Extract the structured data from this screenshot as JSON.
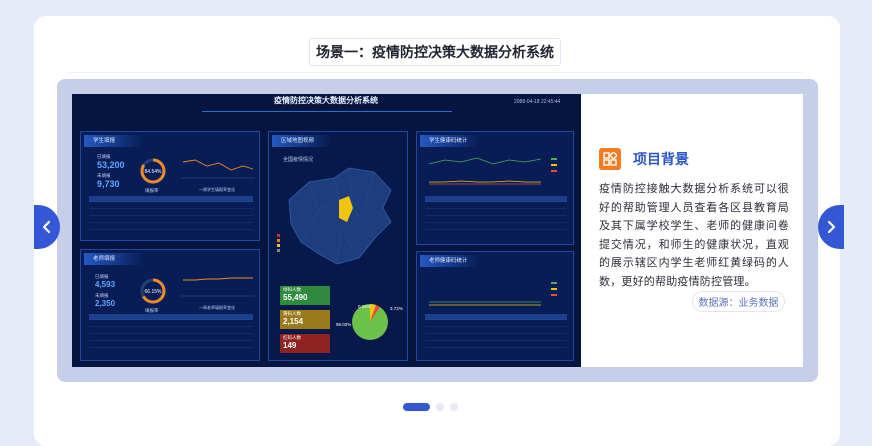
{
  "scene": {
    "title": "场景一：疫情防控决策大数据分析系统"
  },
  "dashboard": {
    "title": "疫情防控决策大数据分析系统",
    "time": "2088-04-18 22:45:44",
    "student_panel": {
      "title": "学生填报",
      "reported_label": "已填报",
      "reported_value": "53,200",
      "unreported_label": "未填报",
      "unreported_value": "9,730",
      "rate": "84.54%",
      "rate_label": "填报率",
      "chart_caption": "一周学生填报率变化"
    },
    "teacher_panel": {
      "title": "老师填报",
      "reported_label": "已填报",
      "reported_value": "4,593",
      "unreported_label": "未填报",
      "unreported_value": "2,350",
      "rate": "66.15%",
      "rate_label": "填报率",
      "chart_caption": "一周老师填报率变化"
    },
    "map_panel": {
      "title": "区域地图视频",
      "subtitle": "全国疫情情况"
    },
    "student_health": {
      "title": "学生健康码统计"
    },
    "teacher_health": {
      "title": "老师健康码统计"
    },
    "codes": {
      "green": {
        "label": "绿码人数",
        "value": "55,490",
        "color": "#2e8a3c"
      },
      "yellow": {
        "label": "黄码人数",
        "value": "2,154",
        "color": "#9b7a1a"
      },
      "red": {
        "label": "红码人数",
        "value": "149",
        "color": "#8f2323"
      }
    },
    "pie": {
      "green_pct": "95.02%",
      "yellow_pct": "0.26%",
      "red_pct": "3.72%"
    }
  },
  "info": {
    "title": "项目背景",
    "icon": "grid-apps-icon",
    "body": "疫情防控接触大数据分析系统可以很好的帮助管理人员查看各区县教育局及其下属学校学生、老师的健康问卷提交情况，和师生的健康状况，直观的展示辖区内学生老师红黄绿码的人数，更好的帮助疫情防控管理。",
    "source": "数据源：业务数据"
  },
  "navigation": {
    "prev_icon": "chevron-left-icon",
    "next_icon": "chevron-right-icon"
  },
  "pagination": {
    "count": 3,
    "active": 1
  },
  "colors": {
    "accent": "#3457d5",
    "orange": "#f47b1f",
    "stage_bg": "#c6cfe9"
  }
}
